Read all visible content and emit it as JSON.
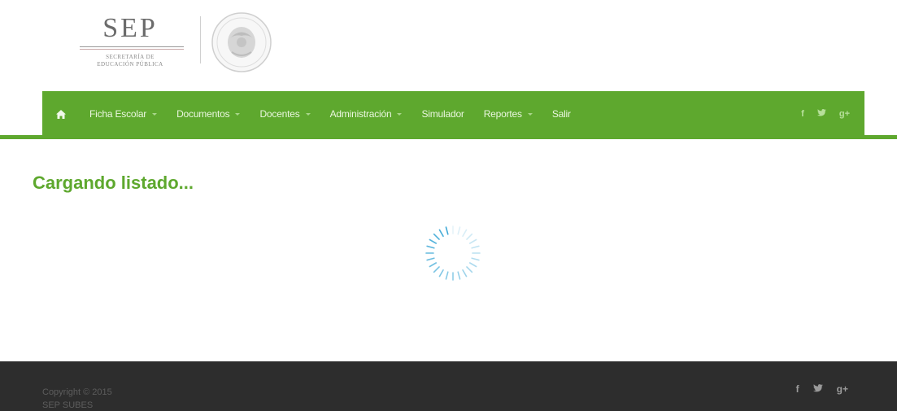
{
  "header": {
    "logo_title": "SEP",
    "logo_subtitle_line1": "SECRETARÍA DE",
    "logo_subtitle_line2": "EDUCACIÓN PÚBLICA"
  },
  "nav": {
    "home_icon": "home-icon",
    "items": [
      {
        "label": "Ficha Escolar",
        "has_dropdown": true
      },
      {
        "label": "Documentos",
        "has_dropdown": true
      },
      {
        "label": "Docentes",
        "has_dropdown": true
      },
      {
        "label": "Administración",
        "has_dropdown": true
      },
      {
        "label": "Simulador",
        "has_dropdown": false
      },
      {
        "label": "Reportes",
        "has_dropdown": true
      },
      {
        "label": "Salir",
        "has_dropdown": false
      }
    ],
    "social": {
      "facebook": "f",
      "twitter": "🐦",
      "googleplus": "g+"
    }
  },
  "main": {
    "loading_title": "Cargando listado..."
  },
  "footer": {
    "copyright_line1": "Copyright © 2015",
    "copyright_line2": "SEP SUBES",
    "social": {
      "facebook": "f",
      "twitter": "🐦",
      "googleplus": "g+"
    }
  },
  "colors": {
    "brand_green": "#5ea82e",
    "spinner_blue": "#3aa7d6",
    "footer_bg": "#2d2d2d"
  }
}
